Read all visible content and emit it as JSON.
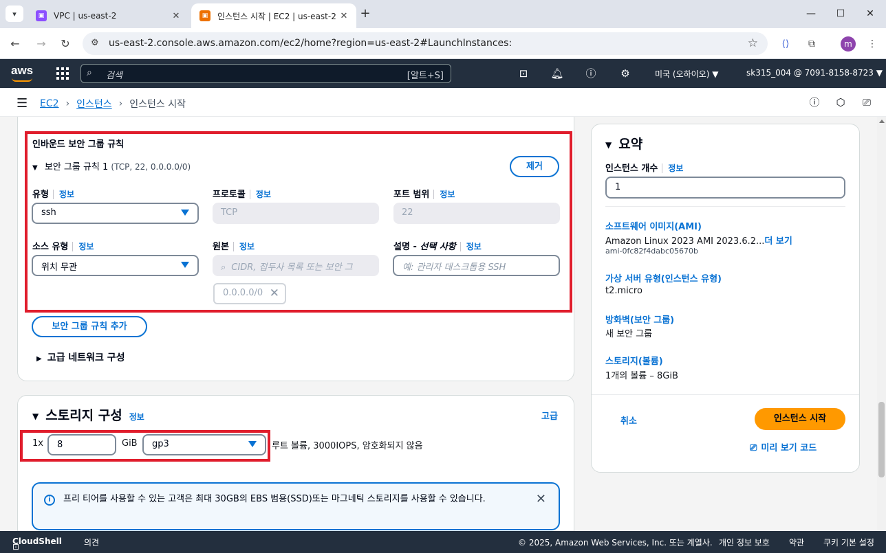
{
  "browser": {
    "tabs": [
      {
        "title": "VPC | us-east-2",
        "favicon": "vpc-icon"
      },
      {
        "title": "인스턴스 시작 | EC2 | us-east-2",
        "favicon": "ec2-icon"
      }
    ],
    "url": "us-east-2.console.aws.amazon.com/ec2/home?region=us-east-2#LaunchInstances:",
    "avatar_letter": "m"
  },
  "awsnav": {
    "logo": "aws",
    "search_placeholder": "검색",
    "search_shortcut": "[알트+S]",
    "region": "미국 (오하이오) ▼",
    "account": "sk315_004 @ 7091-8158-8723 ▼"
  },
  "breadcrumb": {
    "items": [
      "EC2",
      "인스턴스",
      "인스턴스 시작"
    ]
  },
  "network": {
    "inbound_title": "인바운드 보안 그룹 규칙",
    "rule_header": "보안 그룹 규칙 1",
    "rule_detail": "(TCP, 22, 0.0.0.0/0)",
    "remove_button": "제거",
    "info": "정보",
    "type_label": "유형",
    "type_value": "ssh",
    "protocol_label": "프로토콜",
    "protocol_value": "TCP",
    "port_label": "포트 범위",
    "port_value": "22",
    "source_type_label": "소스 유형",
    "source_type_value": "위치 무관",
    "source_label": "원본",
    "source_placeholder": "CIDR, 접두사 목록 또는 보안 그",
    "source_token": "0.0.0.0/0",
    "desc_label_main": "설명 - ",
    "desc_label_opt": "선택 사항",
    "desc_placeholder": "예: 관리자 데스크톱용 SSH",
    "add_rule_button": "보안 그룹 규칙 추가",
    "advanced_network": "고급 네트워크 구성"
  },
  "storage": {
    "title": "스토리지 구성",
    "info": "정보",
    "advanced": "고급",
    "count_prefix": "1x",
    "size_value": "8",
    "unit": "GiB",
    "volume_type": "gp3",
    "description": "루트 볼륨,  3000IOPS,  암호화되지 않음",
    "alert": "프리 티어를 사용할 수 있는 고객은 최대 30GB의 EBS 범용(SSD)또는 마그네틱 스토리지를 사용할 수 있습니다."
  },
  "summary": {
    "title": "요약",
    "count_label": "인스턴스 개수",
    "info": "정보",
    "count_value": "1",
    "ami_label": "소프트웨어 이미지(AMI)",
    "ami_value": "Amazon Linux 2023 AMI 2023.6.2...",
    "ami_more": "더 보기",
    "ami_id": "ami-0fc82f4dabc05670b",
    "type_label": "가상 서버 유형(인스턴스 유형)",
    "type_value": "t2.micro",
    "firewall_label": "방화벽(보안 그룹)",
    "firewall_value": "새 보안 그룹",
    "storage_label": "스토리지(볼륨)",
    "storage_value": "1개의 볼륨 – 8GiB",
    "cancel": "취소",
    "launch": "인스턴스 시작",
    "preview_code": "미리 보기 코드"
  },
  "footer": {
    "cloudshell": "CloudShell",
    "feedback": "의견",
    "copyright": "© 2025, Amazon Web Services, Inc. 또는 계열사.",
    "privacy": "개인 정보 보호",
    "terms": "약관",
    "cookies": "쿠키 기본 설정"
  },
  "colors": {
    "aws_nav": "#232f3e",
    "link_blue": "#0972d3",
    "launch_orange": "#ff9900",
    "highlight_red": "#e01d2c"
  }
}
